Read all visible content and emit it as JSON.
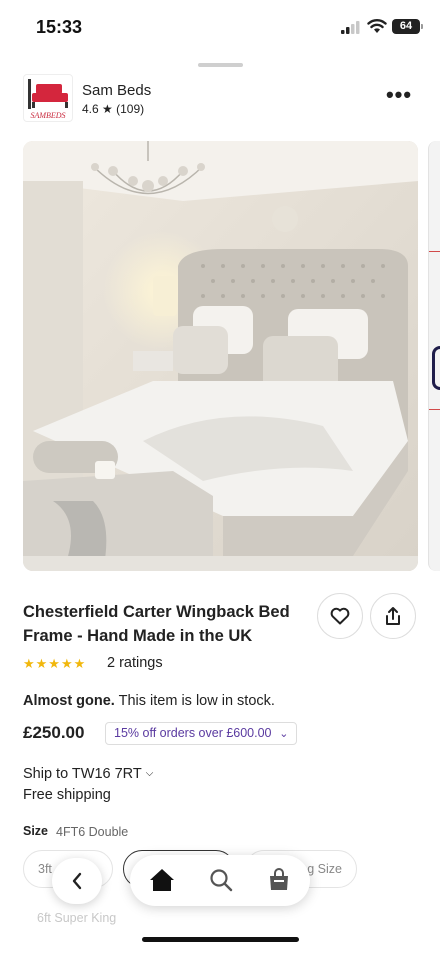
{
  "status_bar": {
    "time": "15:33",
    "battery": "64",
    "icons": [
      "signal-icon",
      "wifi-icon",
      "battery-icon"
    ]
  },
  "shop": {
    "logo_text": "SAMBEDS",
    "name": "Sam Beds",
    "rating": "4.6 ★ (109)",
    "more_label": "•••"
  },
  "product": {
    "image_icon": "bedroom-photo",
    "title": "Chesterfield Carter Wingback Bed Frame - Hand Made in the UK",
    "stars": "★★★★★",
    "stars_value": 5,
    "ratings": "2 ratings",
    "stock_bold": "Almost gone.",
    "stock_text": " This item is low in stock.",
    "price": "£250.00",
    "promo": "15% off orders over £600.00",
    "ship_to": "Ship to TW16 7RT",
    "shipping": "Free shipping",
    "size_label": "Size",
    "size_value": "4FT6 Double",
    "size_options": [
      "3ft",
      "g Size",
      "6ft Super King"
    ]
  },
  "nav": {
    "back_icon": "chevron-left-icon",
    "home_icon": "home-icon",
    "search_icon": "search-icon",
    "cart_icon": "cart-icon"
  },
  "colors": {
    "star": "#f1b70c",
    "promo_text": "#5a3aa0",
    "logo_red": "#c8283c"
  }
}
